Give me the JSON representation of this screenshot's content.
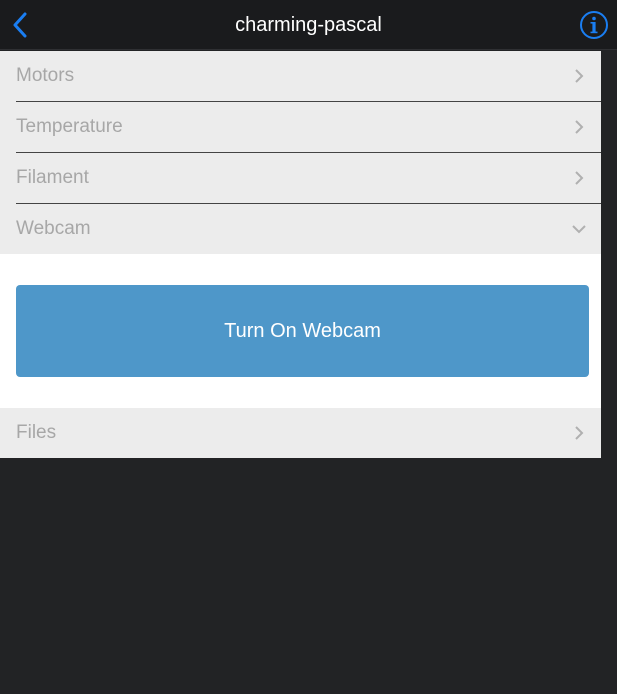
{
  "navbar": {
    "back_icon": "chevron-left-icon",
    "title": "charming-pascal",
    "info_icon": "info-circle-icon",
    "accent_color": "#1a7ef2"
  },
  "sections": [
    {
      "label": "Motors",
      "icon": "chevron-right-icon",
      "expanded": false
    },
    {
      "label": "Temperature",
      "icon": "chevron-right-icon",
      "expanded": false
    },
    {
      "label": "Filament",
      "icon": "chevron-right-icon",
      "expanded": false
    },
    {
      "label": "Webcam",
      "icon": "chevron-down-icon",
      "expanded": true
    },
    {
      "label": "Files",
      "icon": "chevron-right-icon",
      "expanded": false
    }
  ],
  "webcam": {
    "button_label": "Turn On Webcam",
    "button_color": "#4e97c9"
  }
}
